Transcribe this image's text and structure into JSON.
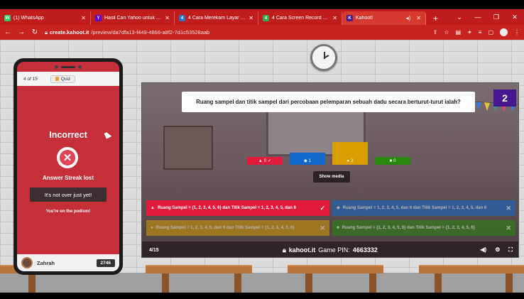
{
  "browser": {
    "tabs": [
      {
        "label": "(1) WhatsApp",
        "icon": "whatsapp-icon",
        "color": "#25d366",
        "glyph": "W"
      },
      {
        "label": "Hasil Cari Yahoo untuk cara m",
        "icon": "yahoo-icon",
        "color": "#6001d2",
        "glyph": "Y"
      },
      {
        "label": "4 Cara Merekam Layar Laptop",
        "icon": "site-icon",
        "color": "#2a72c8",
        "glyph": "4"
      },
      {
        "label": "4 Cara Screen Record di Lapt",
        "icon": "site-icon",
        "color": "#35a853",
        "glyph": "4"
      },
      {
        "label": "Kahoot!",
        "icon": "kahoot-icon",
        "color": "#46178f",
        "glyph": "K"
      }
    ],
    "new_tab_glyph": "+",
    "url_domain": "create.kahoot.it",
    "url_path": "/preview/da7dfa13-f449-4866-a8f2-7d1c53528aab"
  },
  "phone": {
    "question_counter": "4 of 15",
    "quiz_label": "Quiz",
    "result_title": "Incorrect",
    "streak_text": "Answer Streak lost",
    "encourage_text": "It's not over just yet!",
    "podium_text": "You're on the podium!",
    "player_name": "Zahrah",
    "score": "2746"
  },
  "board": {
    "question": "Ruang sampel dan titik sampel dari percobaan pelemparan sebuah dadu secara berturut-turut ialah?",
    "question_number": "2",
    "show_media_label": "Show media",
    "results": [
      {
        "symbol": "▲",
        "count": "0",
        "color": "#e21b3c",
        "correct": true,
        "value": 0.18
      },
      {
        "symbol": "◆",
        "count": "1",
        "color": "#1368ce",
        "correct": false,
        "value": 0.45
      },
      {
        "symbol": "●",
        "count": "2",
        "color": "#d89e00",
        "correct": false,
        "value": 0.85
      },
      {
        "symbol": "■",
        "count": "0",
        "color": "#26890c",
        "correct": false,
        "value": 0.18
      }
    ],
    "answers": [
      {
        "symbol": "▲",
        "text": "Ruang Sampel = {1, 2, 3, 4, 5, 6} dan Titik Sampel = 1, 2, 3, 4, 5, dan 6",
        "color": "#e21b3c",
        "mark": "✓",
        "dim": false
      },
      {
        "symbol": "◆",
        "text": "Ruang Sampel = 1, 2, 3, 4, 5, dan 6 dan Titik Sampel = 1, 2, 3, 4, 5, dan 6",
        "color": "#1368ce",
        "mark": "✕",
        "dim": true
      },
      {
        "symbol": "●",
        "text": "Ruang Sampel = 1, 2, 3, 4, 5, dan 6 dan Titik Sampel = {1, 2, 3, 4, 5, 6}",
        "color": "#d89e00",
        "mark": "✕",
        "dim": true
      },
      {
        "symbol": "■",
        "text": "Ruang Sampel = {1, 2, 3, 4, 5, 6} dan Titik Sampel = {1, 2, 3, 4, 5, 6}",
        "color": "#26890c",
        "mark": "✕",
        "dim": true
      }
    ],
    "progress": "4/15",
    "brand": "kahoot.it",
    "pin_label": "Game PIN:",
    "pin": "4663332"
  }
}
